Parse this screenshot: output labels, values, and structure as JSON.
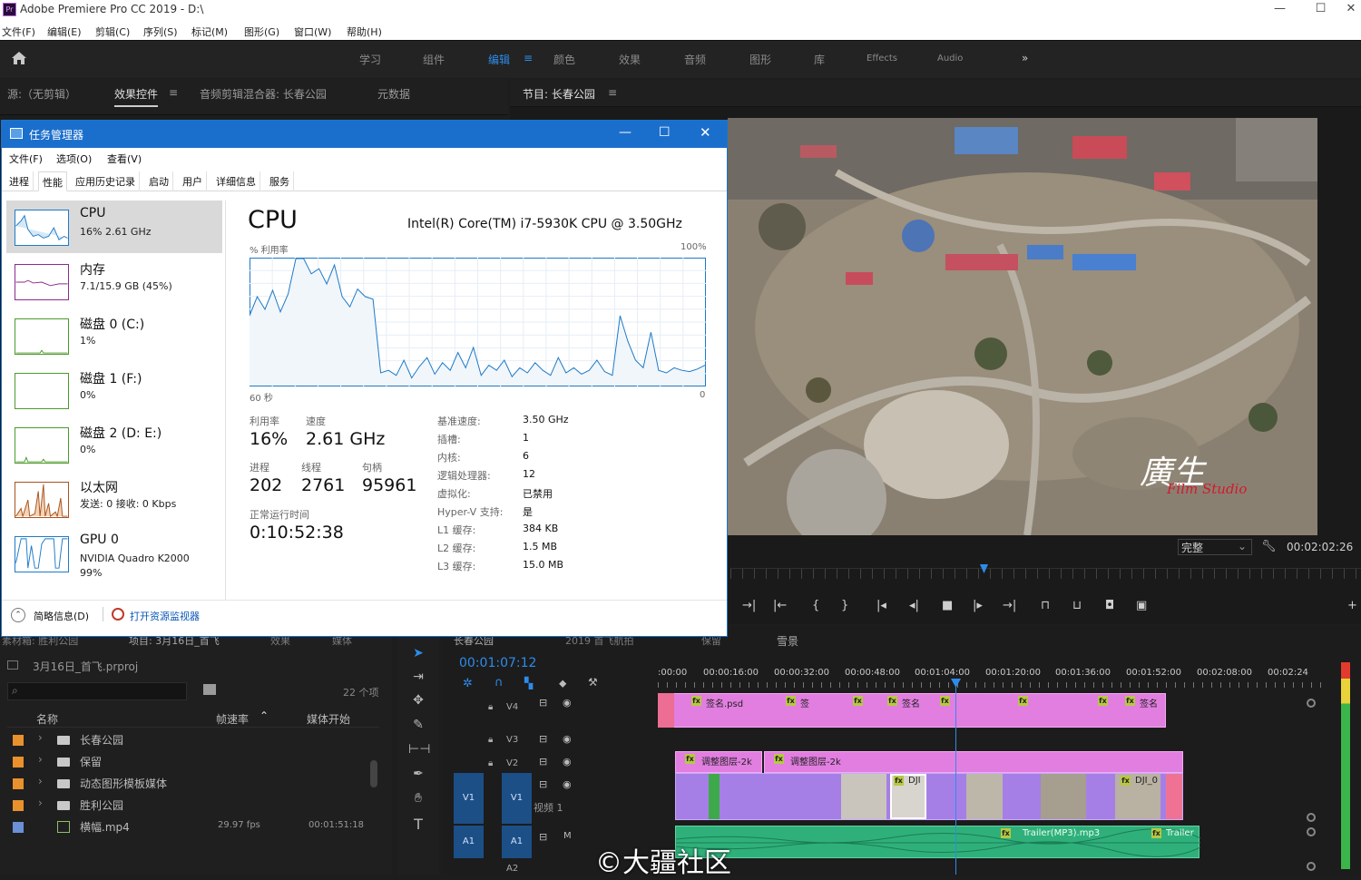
{
  "app": {
    "title": "Adobe Premiere Pro CC 2019 - D:\\",
    "icon": "Pr",
    "menu": [
      "文件(F)",
      "编辑(E)",
      "剪辑(C)",
      "序列(S)",
      "标记(M)",
      "图形(G)",
      "窗口(W)",
      "帮助(H)"
    ],
    "window_buttons": [
      "—",
      "☐",
      "✕"
    ]
  },
  "workspaces": {
    "items": [
      "学习",
      "组件",
      "编辑",
      "颜色",
      "效果",
      "音频",
      "图形",
      "库",
      "Effects",
      "Audio"
    ],
    "active": "编辑",
    "more": "»",
    "menu_icon": "≡"
  },
  "source_panel": {
    "tabs": [
      "源:（无剪辑）",
      "效果控件",
      "音频剪辑混合器: 长春公园",
      "元数据"
    ],
    "active_tab": "效果控件",
    "menu_icon": "≡"
  },
  "program_panel": {
    "title": "节目: 长春公园",
    "menu_icon": "≡",
    "fit": "完整",
    "timecode": "00:02:02:26",
    "watermark_line1": "廣生",
    "watermark_line2": "Film Studio"
  },
  "task_manager": {
    "title": "任务管理器",
    "menu": [
      "文件(F)",
      "选项(O)",
      "查看(V)"
    ],
    "tabs": [
      "进程",
      "性能",
      "应用历史记录",
      "启动",
      "用户",
      "详细信息",
      "服务"
    ],
    "active_tab": "性能",
    "sidebar": [
      {
        "name": "CPU",
        "sub": "16% 2.61 GHz",
        "selected": true
      },
      {
        "name": "内存",
        "sub": "7.1/15.9 GB (45%)"
      },
      {
        "name": "磁盘 0 (C:)",
        "sub": "1%"
      },
      {
        "name": "磁盘 1 (F:)",
        "sub": "0%"
      },
      {
        "name": "磁盘 2 (D: E:)",
        "sub": "0%"
      },
      {
        "name": "以太网",
        "sub": "发送: 0 接收: 0 Kbps"
      },
      {
        "name": "GPU 0",
        "sub": "NVIDIA Quadro K2000",
        "sub2": "99%"
      }
    ],
    "heading": "CPU",
    "cpu_model": "Intel(R) Core(TM) i7-5930K CPU @ 3.50GHz",
    "graph_label_left": "% 利用率",
    "graph_label_right": "100%",
    "graph_axis_left": "60 秒",
    "graph_axis_right": "0",
    "stats": {
      "util_label": "利用率",
      "util": "16%",
      "speed_label": "速度",
      "speed": "2.61 GHz",
      "proc_label": "进程",
      "proc": "202",
      "thread_label": "线程",
      "thread": "2761",
      "handle_label": "句柄",
      "handle": "95961",
      "uptime_label": "正常运行时间",
      "uptime": "0:10:52:38"
    },
    "details": [
      {
        "k": "基准速度:",
        "v": "3.50 GHz"
      },
      {
        "k": "插槽:",
        "v": "1"
      },
      {
        "k": "内核:",
        "v": "6"
      },
      {
        "k": "逻辑处理器:",
        "v": "12"
      },
      {
        "k": "虚拟化:",
        "v": "已禁用"
      },
      {
        "k": "Hyper-V 支持:",
        "v": "是"
      },
      {
        "k": "L1 缓存:",
        "v": "384 KB"
      },
      {
        "k": "L2 缓存:",
        "v": "1.5 MB"
      },
      {
        "k": "L3 缓存:",
        "v": "15.0 MB"
      }
    ],
    "footer_brief": "简略信息(D)",
    "footer_monitor": "打开资源监视器",
    "cpu_history": [
      55,
      70,
      60,
      75,
      58,
      72,
      100,
      100,
      88,
      92,
      80,
      95,
      70,
      62,
      76,
      70,
      68,
      10,
      12,
      8,
      20,
      6,
      15,
      22,
      9,
      18,
      12,
      26,
      14,
      30,
      8,
      16,
      12,
      20,
      7,
      14,
      10,
      18,
      12,
      8,
      22,
      10,
      14,
      9,
      12,
      20,
      11,
      8,
      55,
      35,
      20,
      14,
      42,
      12,
      10,
      14,
      12,
      11,
      13,
      16
    ]
  },
  "project_panel": {
    "tabs": [
      "素材箱: 胜利公园",
      "项目: 3月16日_首飞",
      "效果",
      "媒体"
    ],
    "project_file": "3月16日_首飞.prproj",
    "count": "22 个项",
    "col_name": "名称",
    "col_fps": "帧速率",
    "col_start": "媒体开始",
    "rows": [
      {
        "name": "长春公园",
        "color": "#e8912d",
        "type": "folder"
      },
      {
        "name": "保留",
        "color": "#e8912d",
        "type": "folder"
      },
      {
        "name": "动态图形模板媒体",
        "color": "#e8912d",
        "type": "folder"
      },
      {
        "name": "胜利公园",
        "color": "#e8912d",
        "type": "folder"
      },
      {
        "name": "横幅.mp4",
        "color": "#6b8fd8",
        "type": "clip",
        "fps": "29.97 fps",
        "start": "00:01:51:18"
      }
    ]
  },
  "timeline": {
    "tabs": [
      "长春公园",
      "2019 首飞航拍",
      "保留",
      "雪景"
    ],
    "timecode": "00:01:07:12",
    "ruler": [
      ":00:00",
      "00:00:16:00",
      "00:00:32:00",
      "00:00:48:00",
      "00:01:04:00",
      "00:01:20:00",
      "00:01:36:00",
      "00:01:52:00",
      "00:02:08:00",
      "00:02:24"
    ],
    "tracks": [
      "V4",
      "V3",
      "V2",
      "V1",
      "A1",
      "A2"
    ],
    "v1_name": "视频 1",
    "clip_labels": {
      "v4a": "签名.psd",
      "v4b": "签",
      "v4c": "签名",
      "v4d": "签名",
      "v2a": "调整图层-2k",
      "v2b": "调整图层-2k",
      "dji": "DJI",
      "dji0": "DJI_0",
      "a1a": "Trailer(MP3).mp3",
      "a1b": "Trailer"
    },
    "footer_watermark": "©大疆社区"
  },
  "colors": {
    "accent": "#2d8ceb",
    "tm_blue": "#1b6fcc",
    "clip_pink": "#e27ee0",
    "clip_purple": "#a67fe6",
    "audio_green": "#2fb07a"
  }
}
